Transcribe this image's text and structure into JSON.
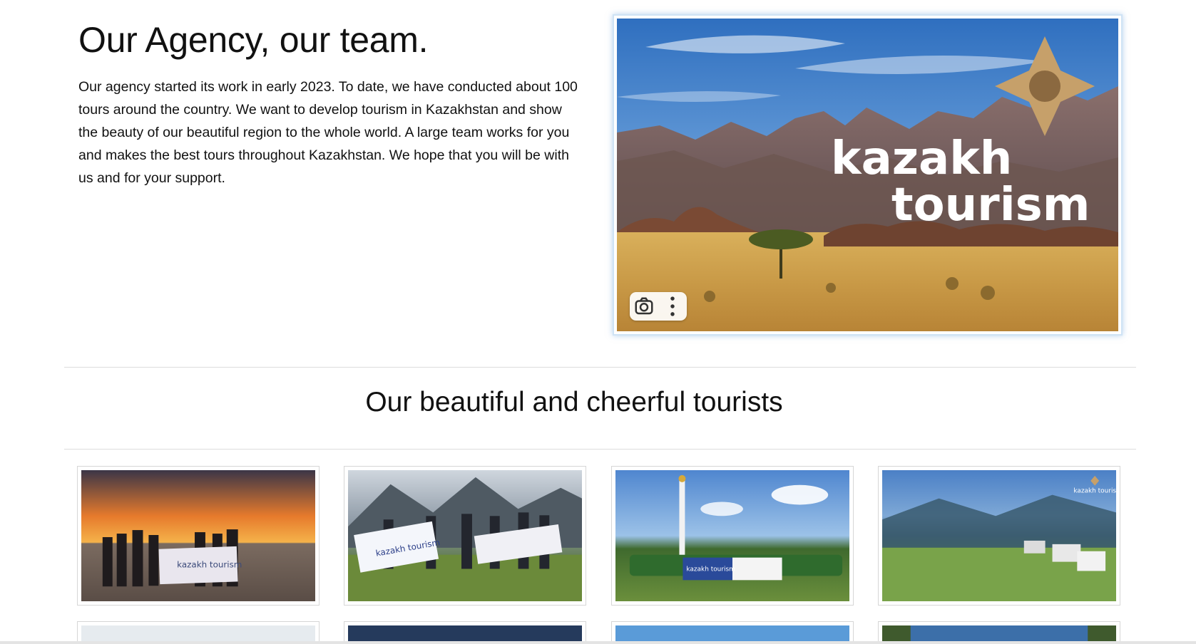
{
  "intro": {
    "title": "Our Agency, our team.",
    "body": "Our agency started its work in early 2023. To date, we have conducted about 100 tours around the country. We want to develop tourism in Kazakhstan and show the beauty of our beautiful region to the whole world. A large team works for you and makes the best tours throughout Kazakhstan. We hope that you will be with us and for your support."
  },
  "hero": {
    "brand_line1": "kazakh",
    "brand_line2": "tourism",
    "toolbar_icons": [
      "camera-search-icon",
      "more-vertical-icon"
    ]
  },
  "gallery": {
    "title": "Our beautiful and cheerful tourists",
    "cards": [
      {
        "banner": "kazakh tourism",
        "scene": "sunset"
      },
      {
        "banner": "kazakh tourism",
        "scene": "mountains"
      },
      {
        "banner": "kazakh tourism",
        "scene": "monument"
      },
      {
        "banner": "kazakh tourism",
        "scene": "valley"
      }
    ]
  },
  "colors": {
    "accent_gold": "#c6a06a",
    "sky": "#3f7dc8",
    "border": "#d6d6d6"
  }
}
